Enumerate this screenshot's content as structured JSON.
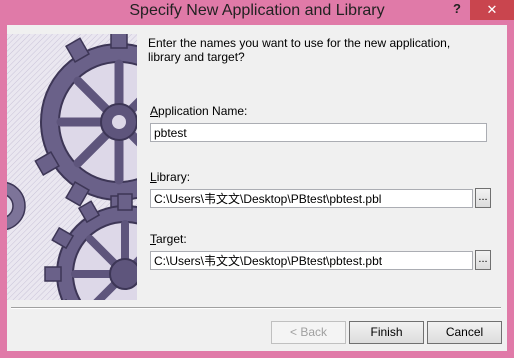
{
  "window": {
    "title": "Specify New Application and Library",
    "help_glyph": "?",
    "close_glyph": "✕"
  },
  "intro_text": "Enter the names you want to use for the new application, library and target?",
  "application": {
    "label_key": "A",
    "label_rest": "pplication Name:",
    "value": "pbtest"
  },
  "library": {
    "label_key": "L",
    "label_rest": "ibrary:",
    "value": "C:\\Users\\韦文文\\Desktop\\PBtest\\pbtest.pbl",
    "browse_label": "..."
  },
  "target": {
    "label_key": "T",
    "label_rest": "arget:",
    "value": "C:\\Users\\韦文文\\Desktop\\PBtest\\pbtest.pbt",
    "browse_label": "..."
  },
  "buttons": {
    "back": "< Back",
    "finish": "Finish",
    "cancel": "Cancel"
  },
  "colors": {
    "title_bar": "#e07aa8",
    "close_button": "#c9454e",
    "gear": "#5e557c"
  }
}
